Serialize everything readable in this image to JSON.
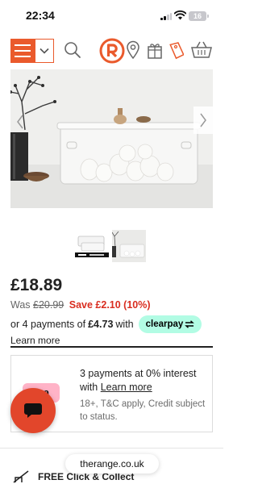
{
  "status_bar": {
    "time": "22:34",
    "battery": "16"
  },
  "header": {
    "icons": [
      "menu-icon",
      "chevron-down-icon",
      "search-icon",
      "the-range-logo",
      "location-pin-icon",
      "gift-icon",
      "price-tag-icon",
      "basket-icon"
    ],
    "accent_color": "#ea5a2c"
  },
  "product": {
    "price": "£18.89",
    "was_label": "Was",
    "was_price": "£20.99",
    "save_text": "Save £2.10 (10%)",
    "payments_prefix": "or 4 payments of",
    "payments_amount": "£4.73",
    "payments_suffix": "with",
    "clearpay_label": "clearpay",
    "learn_more": "Learn more"
  },
  "klarna": {
    "badge": "rna",
    "main_text": "3 payments at 0% interest with",
    "main_link": "Learn more",
    "sub_text": "18+, T&C apply, Credit subject to status."
  },
  "footer": {
    "url": "therange.co.uk",
    "free_click_collect": "FREE Click & Collect"
  },
  "colors": {
    "accent": "#ea5a2c",
    "save_red": "#d92d20",
    "clearpay_mint": "#b2fce4",
    "klarna_pink": "#ffb3c7",
    "chat_button": "#e2462b"
  }
}
